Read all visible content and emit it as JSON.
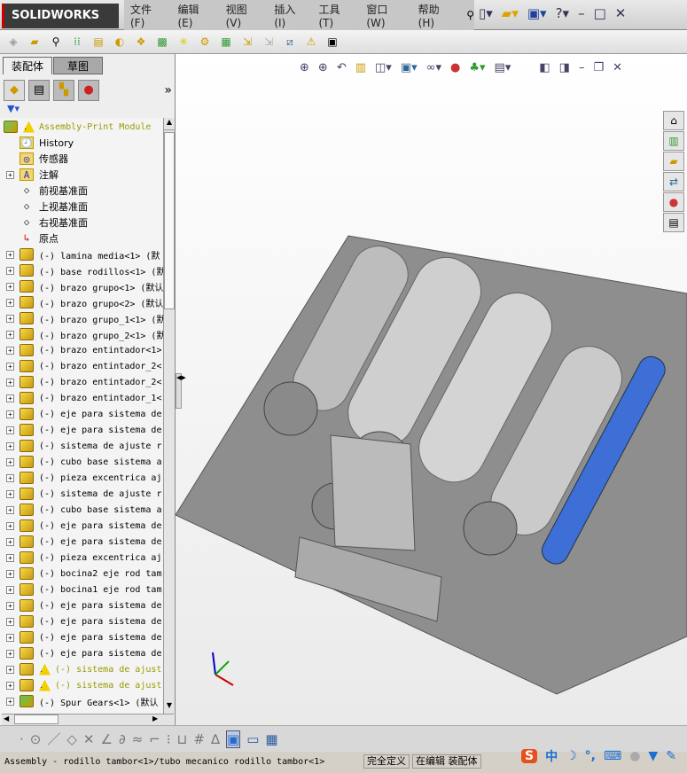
{
  "app": {
    "logo": "SOLIDWORKS"
  },
  "menu": [
    "文件(F)",
    "编辑(E)",
    "视图(V)",
    "插入(I)",
    "工具(T)",
    "窗口(W)",
    "帮助(H)"
  ],
  "feature_manager": {
    "tabs": [
      "装配体",
      "草图"
    ],
    "expand_label": "»",
    "root": "Assembly-Print Module",
    "fixed_items": [
      "History",
      "传感器",
      "注解",
      "前视基准面",
      "上视基准面",
      "右视基准面",
      "原点"
    ],
    "components": [
      {
        "label": "(-) lamina media<1> (默",
        "warn": false
      },
      {
        "label": "(-) base rodillos<1> (默",
        "warn": false
      },
      {
        "label": "(-) brazo grupo<1> (默认",
        "warn": false
      },
      {
        "label": "(-) brazo grupo<2> (默认",
        "warn": false
      },
      {
        "label": "(-) brazo grupo_1<1> (默",
        "warn": false
      },
      {
        "label": "(-) brazo grupo_2<1> (默",
        "warn": false
      },
      {
        "label": "(-) brazo entintador<1>",
        "warn": false
      },
      {
        "label": "(-) brazo entintador_2<",
        "warn": false
      },
      {
        "label": "(-) brazo entintador_2<",
        "warn": false
      },
      {
        "label": "(-) brazo entintador_1<",
        "warn": false
      },
      {
        "label": "(-) eje para sistema de",
        "warn": false
      },
      {
        "label": "(-) eje para sistema de",
        "warn": false
      },
      {
        "label": "(-) sistema de ajuste r",
        "warn": false
      },
      {
        "label": "(-) cubo base sistema a",
        "warn": false
      },
      {
        "label": "(-) pieza excentrica aj",
        "warn": false
      },
      {
        "label": "(-) sistema de ajuste r",
        "warn": false
      },
      {
        "label": "(-) cubo base sistema a",
        "warn": false
      },
      {
        "label": "(-) eje para sistema de",
        "warn": false
      },
      {
        "label": "(-) eje para sistema de",
        "warn": false
      },
      {
        "label": "(-) pieza excentrica aj",
        "warn": false
      },
      {
        "label": "(-) bocina2 eje rod tam",
        "warn": false
      },
      {
        "label": "(-) bocina1 eje rod tam",
        "warn": false
      },
      {
        "label": "(-) eje para sistema de",
        "warn": false
      },
      {
        "label": "(-) eje para sistema de",
        "warn": false
      },
      {
        "label": "(-) eje para sistema de",
        "warn": false
      },
      {
        "label": "(-) eje para sistema de",
        "warn": false
      },
      {
        "label": "(-) sistema de ajust",
        "warn": true
      },
      {
        "label": "(-) sistema de ajust",
        "warn": true
      },
      {
        "label": "(-) Spur Gears<1> (默认",
        "warn": false,
        "assembly": true
      }
    ]
  },
  "status": {
    "path": "Assembly - rodillo tambor<1>/tubo mecanico rodillo tambor<1>",
    "state": "完全定义",
    "mode": "在编辑 装配体"
  },
  "ime": {
    "lang": "中"
  },
  "colors": {
    "roller_blue": "#3d6fd6",
    "plate": "#8e8e8e",
    "roller": "#c9c9c9"
  }
}
